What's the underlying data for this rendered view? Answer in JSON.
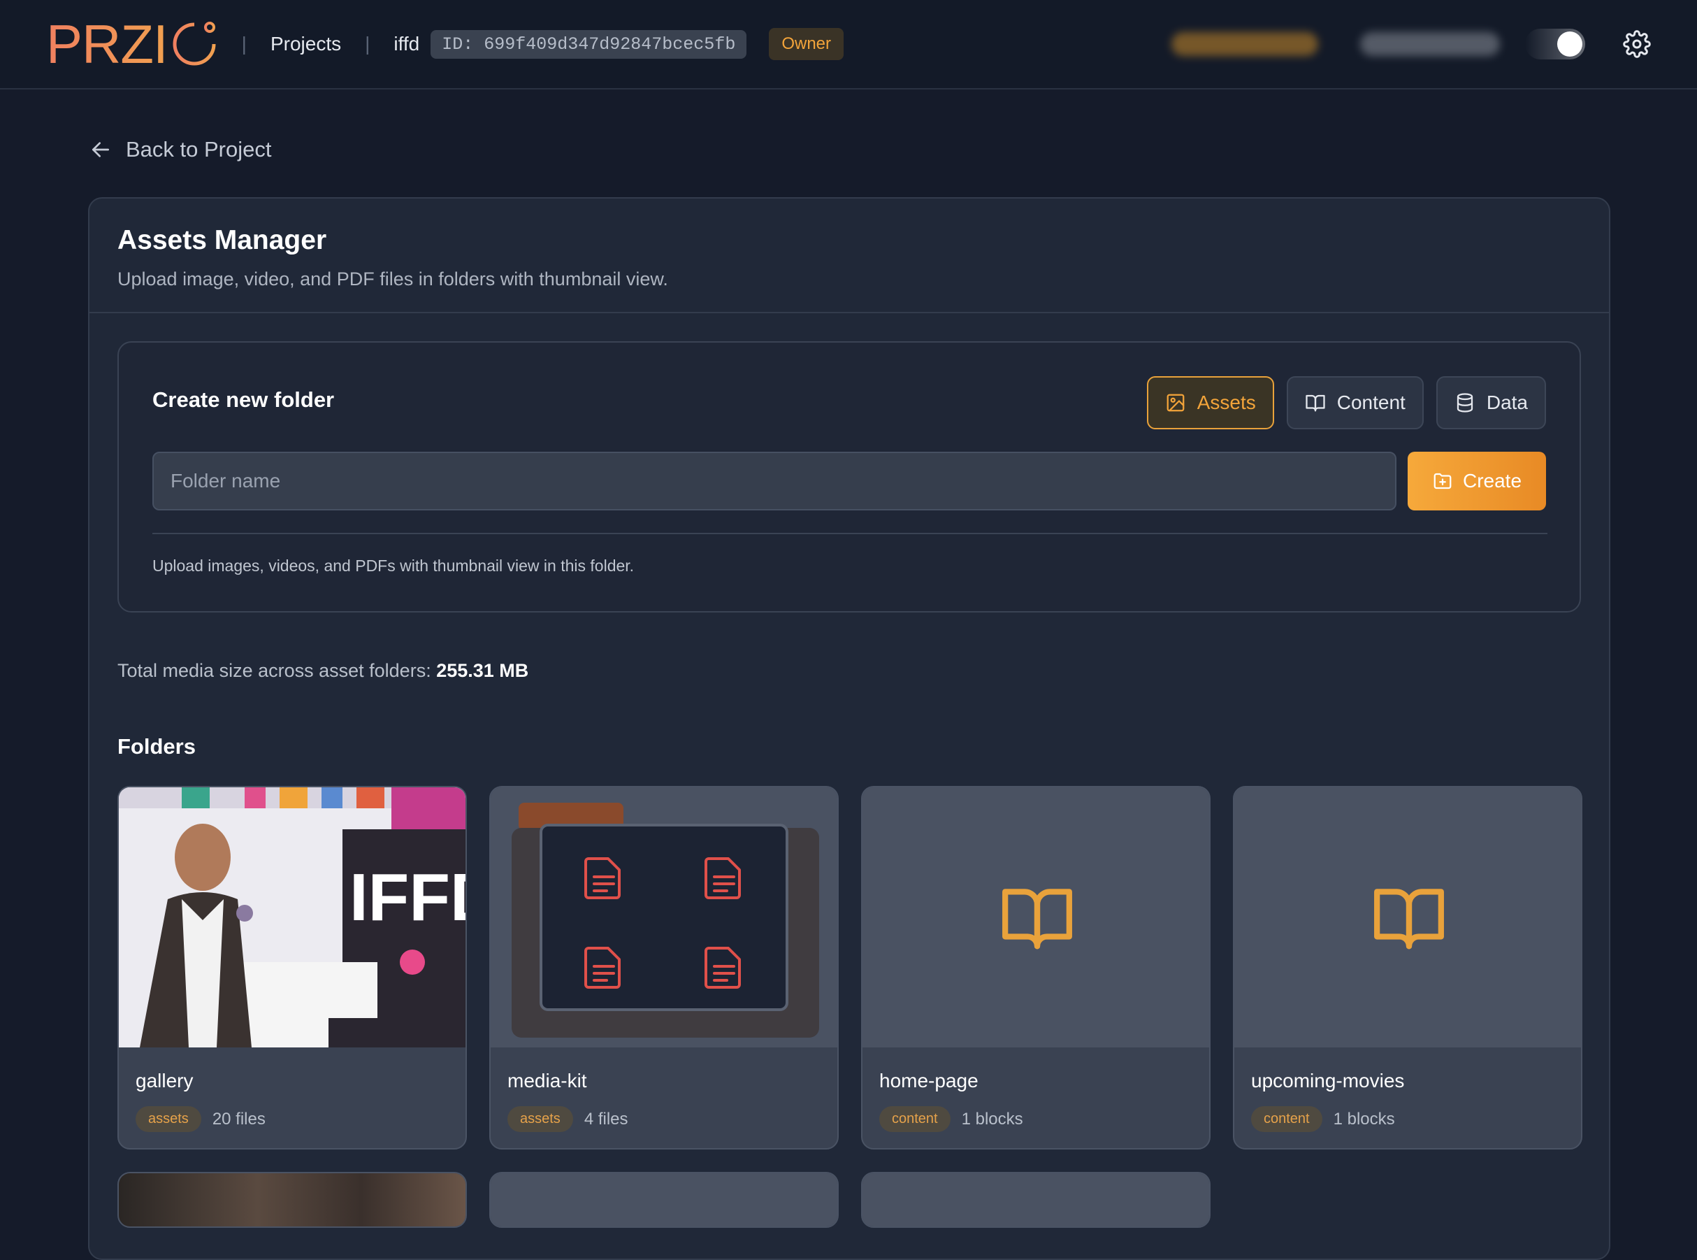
{
  "header": {
    "logo_text": "PRZI",
    "nav_projects": "Projects",
    "project_name": "iffd",
    "project_id": "ID: 699f409d347d92847bcec5fb",
    "role_badge": "Owner"
  },
  "back_link": "Back to Project",
  "page": {
    "title": "Assets Manager",
    "subtitle": "Upload image, video, and PDF files in folders with thumbnail view."
  },
  "create_folder": {
    "title": "Create new folder",
    "types": [
      {
        "label": "Assets",
        "icon": "image-icon",
        "active": true
      },
      {
        "label": "Content",
        "icon": "book-open-icon",
        "active": false
      },
      {
        "label": "Data",
        "icon": "database-icon",
        "active": false
      }
    ],
    "input_placeholder": "Folder name",
    "input_value": "",
    "create_label": "Create",
    "hint": "Upload images, videos, and PDFs with thumbnail view in this folder."
  },
  "total_size": {
    "label": "Total media size across asset folders: ",
    "value": "255.31 MB"
  },
  "folders_title": "Folders",
  "folders": [
    {
      "name": "gallery",
      "tag": "assets",
      "count": "20 files",
      "thumb": "photo"
    },
    {
      "name": "media-kit",
      "tag": "assets",
      "count": "4 files",
      "thumb": "pdf-stack"
    },
    {
      "name": "home-page",
      "tag": "content",
      "count": "1 blocks",
      "thumb": "book"
    },
    {
      "name": "upcoming-movies",
      "tag": "content",
      "count": "1 blocks",
      "thumb": "book"
    }
  ],
  "colors": {
    "accent": "#f3a43a",
    "background": "#151b2a",
    "card": "#202838",
    "pdf_icon": "#e0504a"
  }
}
